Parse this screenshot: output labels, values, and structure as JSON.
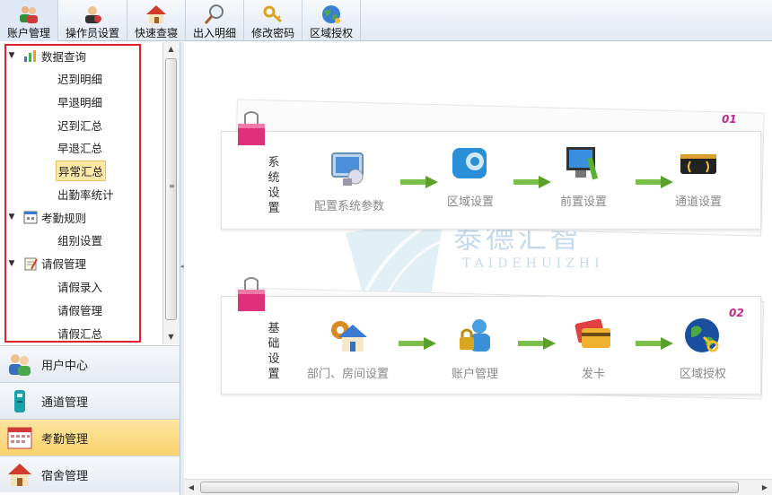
{
  "toolbar": {
    "items": [
      {
        "label": "账户管理",
        "icon": "users-icon"
      },
      {
        "label": "操作员设置",
        "icon": "operator-icon"
      },
      {
        "label": "快速查寝",
        "icon": "home-icon"
      },
      {
        "label": "出入明细",
        "icon": "magnifier-icon"
      },
      {
        "label": "修改密码",
        "icon": "key-icon"
      },
      {
        "label": "区域授权",
        "icon": "globe-icon"
      }
    ]
  },
  "tree": {
    "groups": [
      {
        "label": "数据查询",
        "icon": "chart-icon",
        "items": [
          "迟到明细",
          "早退明细",
          "迟到汇总",
          "早退汇总",
          "异常汇总",
          "出勤率统计"
        ]
      },
      {
        "label": "考勤规则",
        "icon": "calendar-icon",
        "items": [
          "组别设置"
        ]
      },
      {
        "label": "请假管理",
        "icon": "note-icon",
        "items": [
          "请假录入",
          "请假管理",
          "请假汇总"
        ]
      }
    ],
    "selected": "异常汇总"
  },
  "accordion": {
    "items": [
      {
        "label": "用户中心",
        "icon": "user-center-icon"
      },
      {
        "label": "通道管理",
        "icon": "channel-icon"
      },
      {
        "label": "考勤管理",
        "icon": "calendar-grid-icon",
        "active": true
      },
      {
        "label": "宿舍管理",
        "icon": "dorm-icon"
      }
    ]
  },
  "panels": {
    "system": {
      "title": "系统设置",
      "number": "01",
      "steps": [
        "配置系统参数",
        "区域设置",
        "前置设置",
        "通道设置"
      ]
    },
    "basic": {
      "title": "基础设置",
      "number": "02",
      "steps": [
        "部门、房间设置",
        "账户管理",
        "发卡",
        "区域授权"
      ]
    }
  },
  "watermark": {
    "cn": "泰德汇智",
    "en": "TAIDEHUIZHI"
  },
  "colors": {
    "accent": "#c2278a",
    "selection": "#fde8a8",
    "highlight_box": "#e0202a",
    "active_tab": "#f9d26b"
  }
}
